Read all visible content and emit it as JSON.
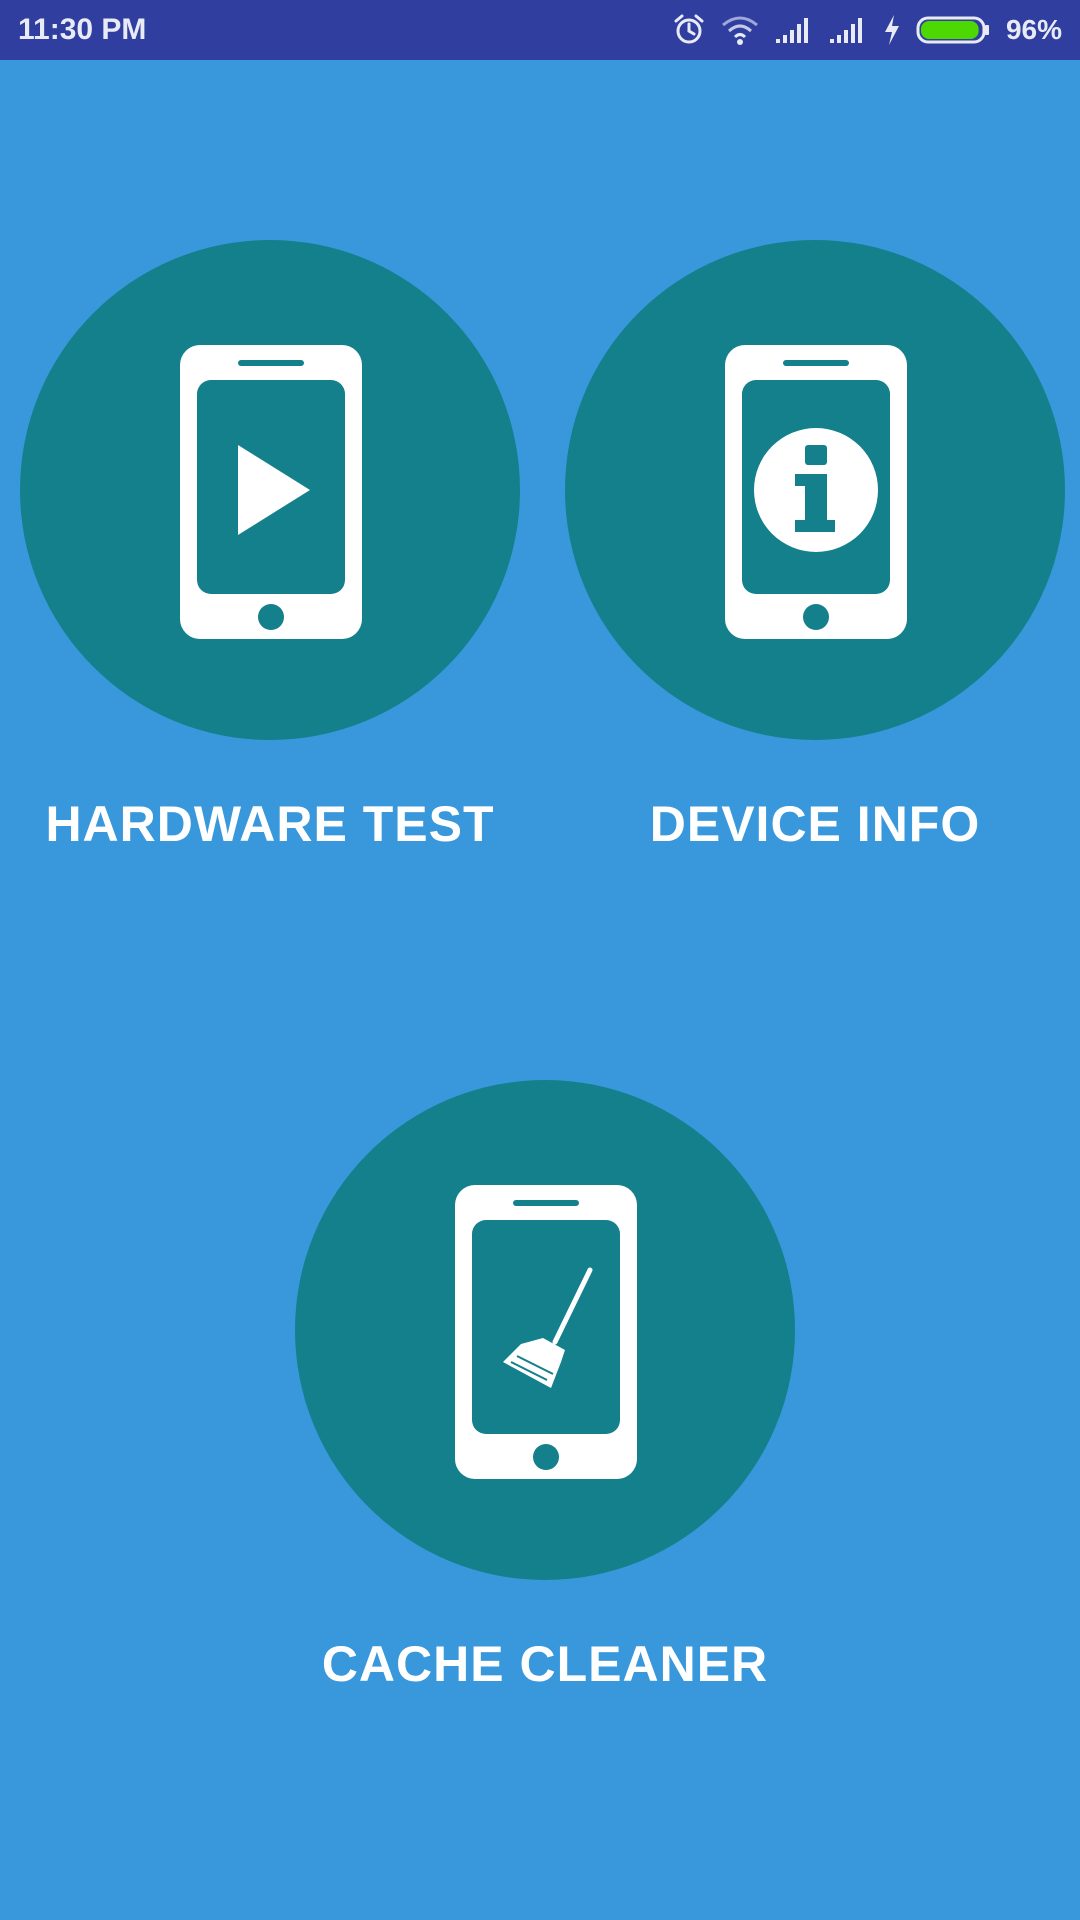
{
  "status_bar": {
    "time": "11:30 PM",
    "battery_percent": "96%",
    "battery_level": 0.96,
    "icons": [
      "alarm-icon",
      "wifi-icon",
      "signal-icon",
      "signal-icon",
      "charging-icon",
      "battery-icon"
    ],
    "battery_color": "#4cd800"
  },
  "colors": {
    "background": "#3898db",
    "circle": "#13808b",
    "status_bar": "#303f9f",
    "label": "#ffffff"
  },
  "tiles": [
    {
      "label": "HARDWARE TEST",
      "icon": "phone-play-icon"
    },
    {
      "label": "DEVICE INFO",
      "icon": "phone-info-icon"
    },
    {
      "label": "CACHE CLEANER",
      "icon": "phone-broom-icon"
    }
  ]
}
